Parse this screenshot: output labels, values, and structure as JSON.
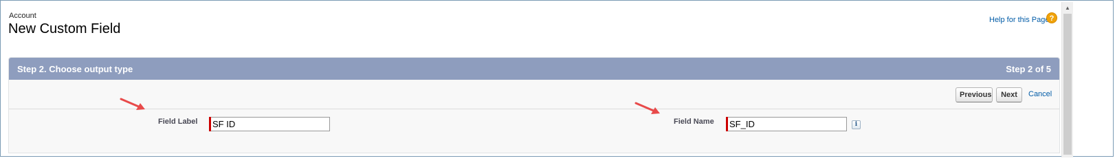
{
  "page": {
    "object_name": "Account",
    "title": "New Custom Field",
    "help_link": "Help for this Page"
  },
  "step": {
    "title": "Step 2. Choose output type",
    "counter": "Step 2 of 5"
  },
  "buttons": {
    "previous": "Previous",
    "next": "Next",
    "cancel": "Cancel"
  },
  "fields": {
    "field_label": {
      "label": "Field Label",
      "value": "SF ID"
    },
    "field_name": {
      "label": "Field Name",
      "value": "SF_ID"
    }
  },
  "icons": {
    "help": "help-question-icon",
    "info": "info-icon",
    "annotation": "red-arrow-icon"
  },
  "colors": {
    "header_bar": "#8e9dbe",
    "required": "#cc0000",
    "link": "#015ba7",
    "help_icon": "#f0a30a",
    "annotation_arrow": "#e84a4a"
  }
}
